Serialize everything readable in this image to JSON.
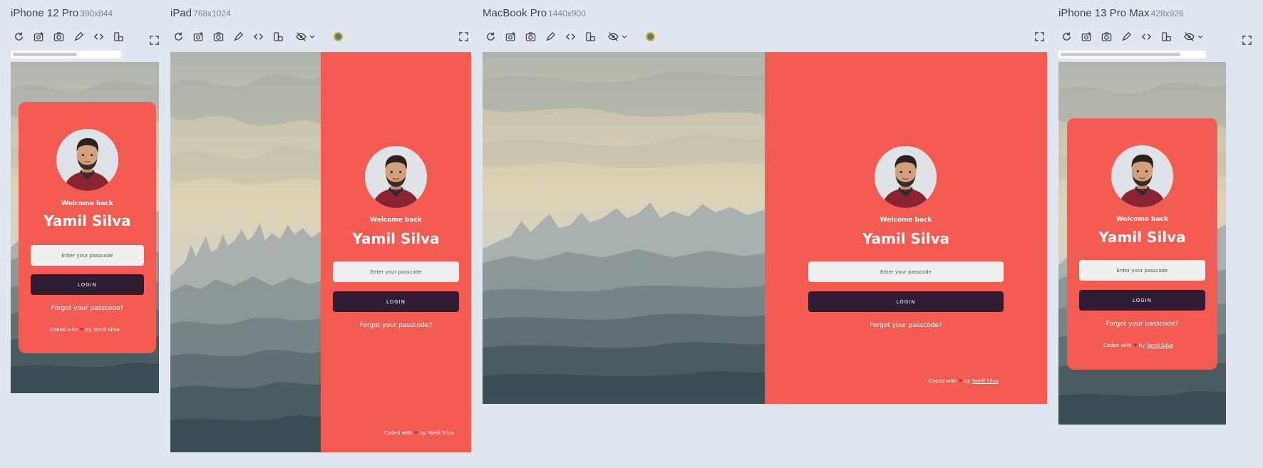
{
  "devices": [
    {
      "name": "iPhone 12 Pro",
      "size": "390x844"
    },
    {
      "name": "iPad",
      "size": "768x1024"
    },
    {
      "name": "MacBook Pro",
      "size": "1440x900"
    },
    {
      "name": "iPhone 13 Pro Max",
      "size": "428x926"
    }
  ],
  "toolbar_icons": [
    "refresh-icon",
    "screenshot-icon",
    "camera-icon",
    "pen-icon",
    "code-icon",
    "rotate-icon",
    "hide-icon",
    "chevron-down-icon",
    "browser-icon",
    "fullscreen-icon"
  ],
  "login": {
    "welcome": "Welcome back",
    "name": "Yamil Silva",
    "passcode_placeholder": "Enter your passcode",
    "login_label": "LOGIN",
    "forgot": "Forgot your passcode?",
    "coded_prefix": "Coded with",
    "coded_by": "by",
    "author": "Yamil Silva"
  },
  "colors": {
    "card": "#f45b52",
    "button": "#2e1d33",
    "input": "#efefef",
    "heart": "#e81820",
    "page_bg": "#e1e7f0"
  }
}
